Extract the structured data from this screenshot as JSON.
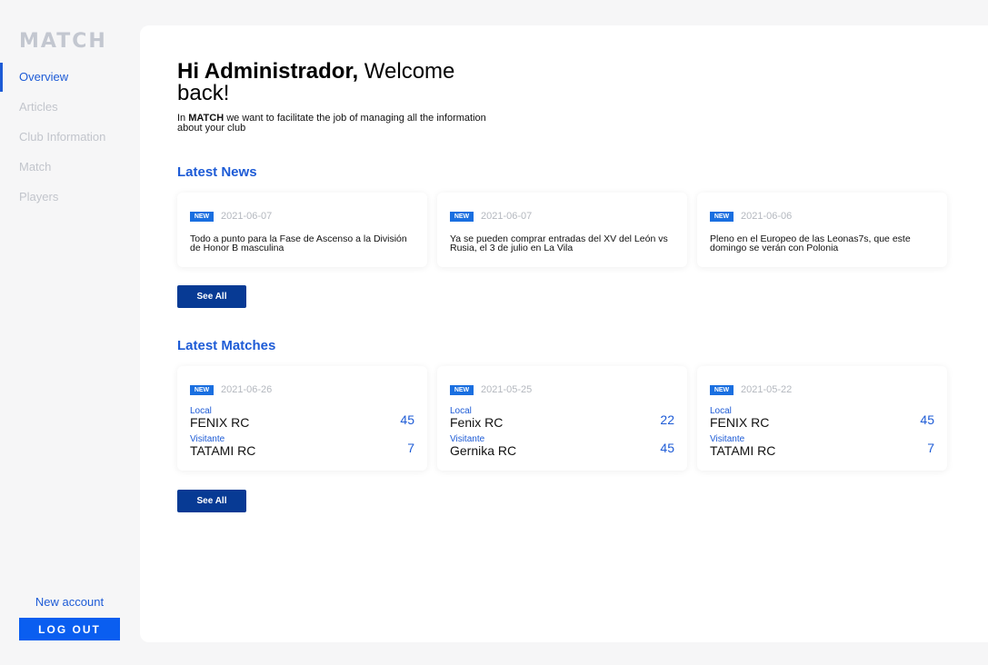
{
  "app": {
    "logo": "MATCH"
  },
  "sidebar": {
    "items": [
      {
        "label": "Overview",
        "active": true
      },
      {
        "label": "Articles",
        "active": false
      },
      {
        "label": "Club Information",
        "active": false
      },
      {
        "label": "Match",
        "active": false
      },
      {
        "label": "Players",
        "active": false
      }
    ],
    "new_account": "New account",
    "logout": "LOG OUT"
  },
  "header": {
    "greeting_bold": "Hi Administrador,",
    "greeting_rest": " Welcome back!",
    "intro_pre": "In ",
    "intro_brand": "MATCH",
    "intro_post": " we want to facilitate the job of managing all the information about your club"
  },
  "news": {
    "title": "Latest News",
    "see_all": "See All",
    "items": [
      {
        "badge": "NEW",
        "date": "2021-06-07",
        "text": "Todo a punto para la Fase de Ascenso a la División de Honor B masculina"
      },
      {
        "badge": "NEW",
        "date": "2021-06-07",
        "text": "Ya se pueden comprar entradas del XV del León vs Rusia, el 3 de julio en La Vila"
      },
      {
        "badge": "NEW",
        "date": "2021-06-06",
        "text": "Pleno en el Europeo de las Leonas7s, que este domingo se verán con Polonia"
      }
    ]
  },
  "matches": {
    "title": "Latest Matches",
    "see_all": "See All",
    "items": [
      {
        "badge": "NEW",
        "date": "2021-06-26",
        "local_label": "Local",
        "local_team": "FENIX RC",
        "local_score": "45",
        "visitor_label": "Visitante",
        "visitor_team": "TATAMI RC",
        "visitor_score": "7"
      },
      {
        "badge": "NEW",
        "date": "2021-05-25",
        "local_label": "Local",
        "local_team": "Fenix RC",
        "local_score": "22",
        "visitor_label": "Visitante",
        "visitor_team": "Gernika RC",
        "visitor_score": "45"
      },
      {
        "badge": "NEW",
        "date": "2021-05-22",
        "local_label": "Local",
        "local_team": "FENIX RC",
        "local_score": "45",
        "visitor_label": "Visitante",
        "visitor_team": "TATAMI RC",
        "visitor_score": "7"
      }
    ]
  },
  "colors": {
    "accent": "#1d5bd6",
    "button_dark": "#073a94",
    "logout_button": "#0a5ef0",
    "badge": "#1a6fe0"
  }
}
